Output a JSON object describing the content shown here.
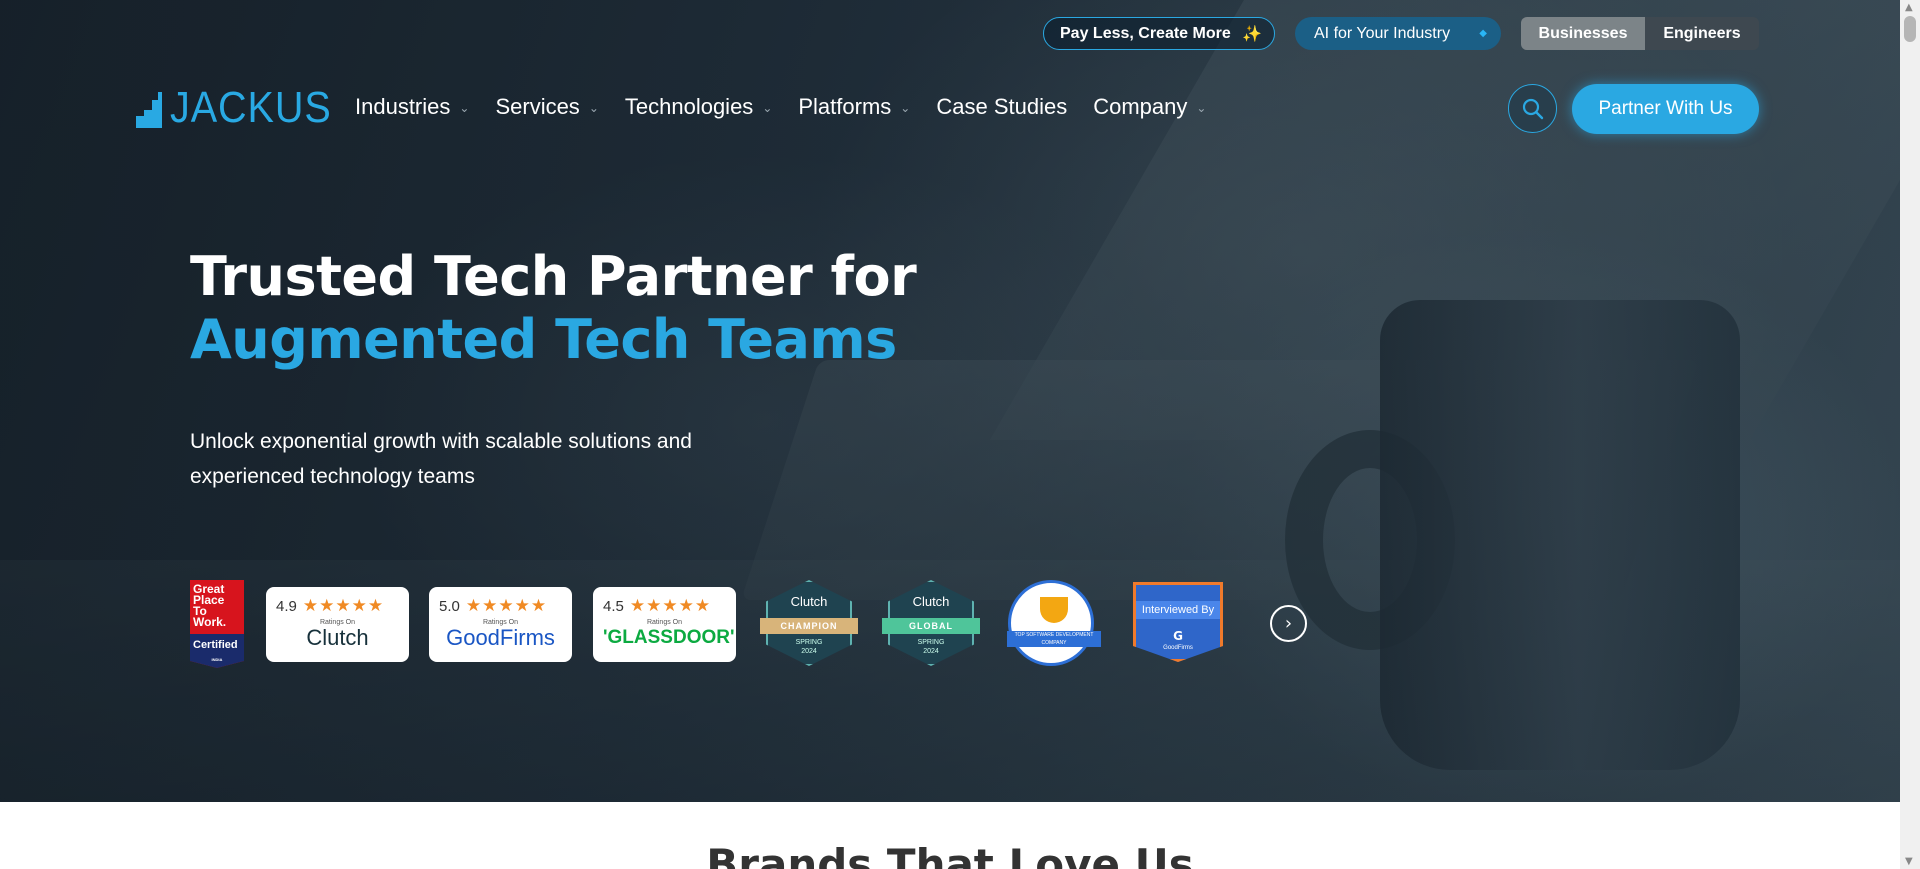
{
  "topbar": {
    "pay_less": "Pay Less, Create More",
    "ai_industry": "AI for Your Industry",
    "toggle": [
      "Businesses",
      "Engineers"
    ]
  },
  "logo": {
    "text": "JACKUS"
  },
  "nav": {
    "items": [
      {
        "label": "Industries",
        "dropdown": true
      },
      {
        "label": "Services",
        "dropdown": true
      },
      {
        "label": "Technologies",
        "dropdown": true
      },
      {
        "label": "Platforms",
        "dropdown": true
      },
      {
        "label": "Case Studies",
        "dropdown": false
      },
      {
        "label": "Company",
        "dropdown": true
      }
    ],
    "search_icon": "search-icon",
    "cta": "Partner With Us"
  },
  "hero": {
    "title_line1": "Trusted Tech Partner for",
    "title_line2": "Augmented Tech Teams",
    "subtitle_line1": "Unlock exponential growth with scalable solutions and",
    "subtitle_line2": "experienced technology teams"
  },
  "badges": {
    "gptw": {
      "l1": "Great",
      "l2": "Place",
      "l3": "To",
      "l4": "Work.",
      "cert": "Certified",
      "region": "INDIA"
    },
    "ratings": [
      {
        "score": "4.9",
        "stars": "★★★★★",
        "ratings_on": "Ratings On",
        "brand": "Clutch",
        "color": "#17313b"
      },
      {
        "score": "5.0",
        "stars": "★★★★★",
        "ratings_on": "Ratings On",
        "brand": "GoodFirms",
        "color": "#1a56c4"
      },
      {
        "score": "4.5",
        "stars": "★★★★★",
        "ratings_on": "Ratings On",
        "brand": "'GLASSDOOR'",
        "color": "#0caa41"
      }
    ],
    "clutch_champion": {
      "brand": "Clutch",
      "ribbon": "CHAMPION",
      "season": "SPRING",
      "year": "2024"
    },
    "clutch_global": {
      "brand": "Clutch",
      "ribbon": "GLOBAL",
      "season": "SPRING",
      "year": "2024"
    },
    "top_software": {
      "text": "TOP SOFTWARE DEVELOPMENT COMPANY"
    },
    "interviewed": {
      "label": "Interviewed By",
      "brand": "GoodFirms"
    }
  },
  "brands": {
    "title": "Brands That Love Us"
  },
  "colors": {
    "accent": "#2aa8e2",
    "star": "#f08a24"
  }
}
